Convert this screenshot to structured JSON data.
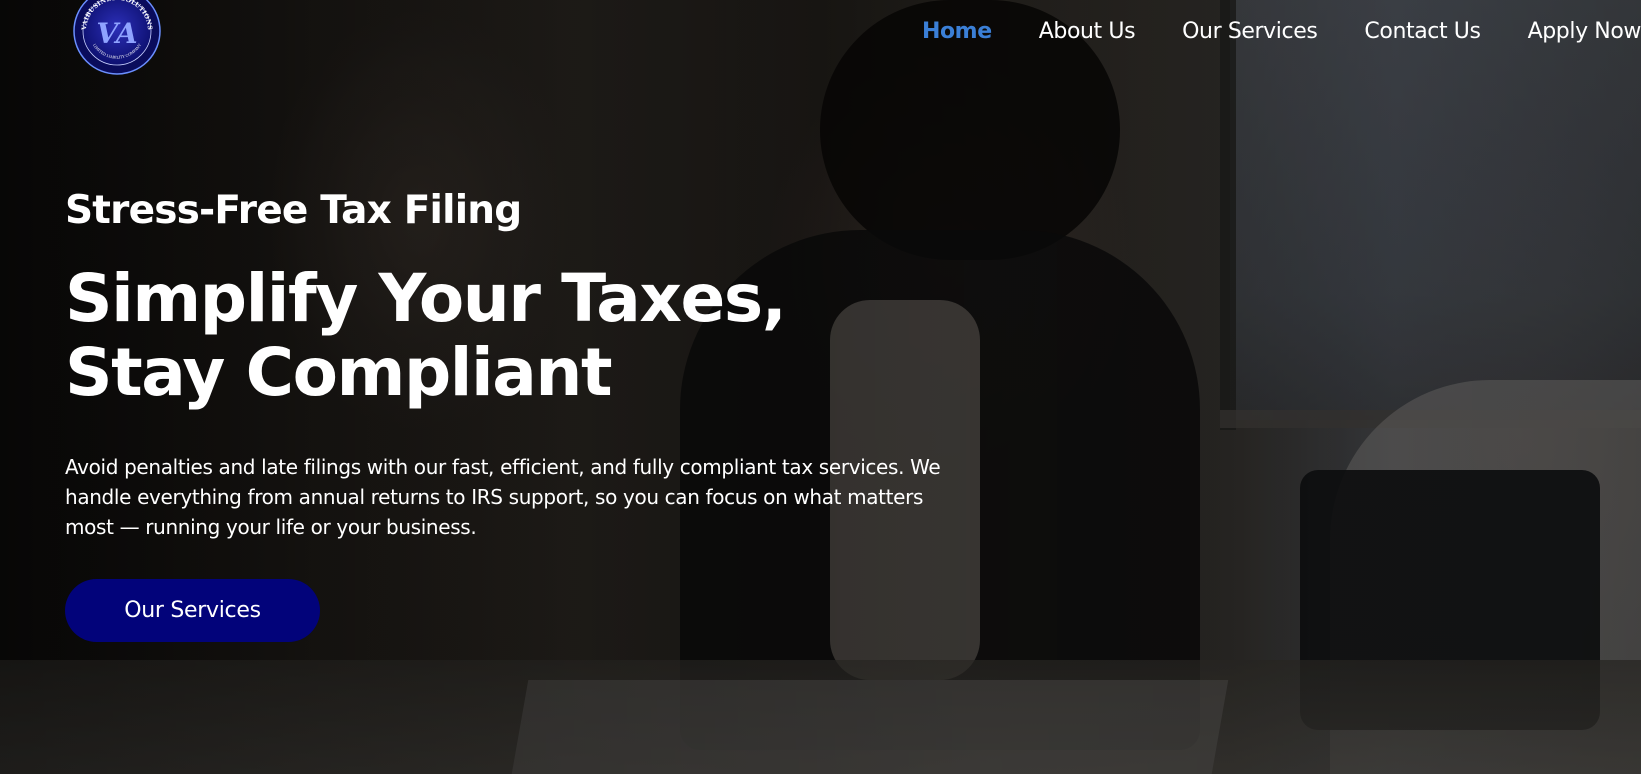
{
  "brand": {
    "logo_ring_text": "VAIBUSINESSSOLUTIONS",
    "logo_bottom_text": "LIMITED LIABILITY COMPANY",
    "logo_monogram": "VA"
  },
  "nav": {
    "items": [
      {
        "label": "Home",
        "active": true
      },
      {
        "label": "About Us",
        "active": false
      },
      {
        "label": "Our Services",
        "active": false
      },
      {
        "label": "Contact Us",
        "active": false
      },
      {
        "label": "Apply Now",
        "active": false
      }
    ],
    "active_color": "#3b7fd6"
  },
  "hero": {
    "eyebrow": "Stress-Free Tax Filing",
    "headline": "Simplify Your Taxes, Stay Compliant",
    "description": "Avoid penalties and late filings with our fast, efficient, and fully compliant tax services. We handle everything from annual returns to IRS support, so you can focus on what matters most — running your life or your business.",
    "cta_label": "Our Services",
    "cta_color": "#02037a"
  }
}
